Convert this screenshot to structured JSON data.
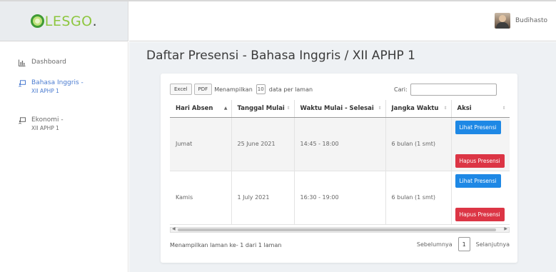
{
  "brand": {
    "name": "LESGO",
    "dot": "."
  },
  "user": {
    "name": "Budihasto"
  },
  "sidebar": {
    "items": [
      {
        "label": "Dashboard",
        "sub": "",
        "icon": "chart-icon"
      },
      {
        "label": "Bahasa Inggris -",
        "sub": "XII APHP 1",
        "icon": "class-board-icon",
        "active": true
      },
      {
        "label": "Ekonomi -",
        "sub": "XII APHP 1",
        "icon": "class-board-icon"
      }
    ]
  },
  "page": {
    "title": "Daftar Presensi - Bahasa Inggris / XII APHP 1"
  },
  "toolbar": {
    "excel_label": "Excel",
    "pdf_label": "PDF",
    "show_prefix": "Menampilkan",
    "page_length": "10",
    "show_suffix": "data per laman",
    "search_label": "Cari:",
    "search_value": ""
  },
  "table": {
    "columns": [
      "Hari Absen",
      "Tanggal Mulai",
      "Waktu Mulai - Selesai",
      "Jangka Waktu",
      "Aksi"
    ],
    "rows": [
      {
        "hari": "Jumat",
        "tanggal": "25 June 2021",
        "waktu": "14:45 - 18:00",
        "jangka": "6 bulan (1 smt)",
        "lihat": "Lihat Presensi",
        "hapus": "Hapus Presensi"
      },
      {
        "hari": "Kamis",
        "tanggal": "1 July 2021",
        "waktu": "16:30 - 19:00",
        "jangka": "6 bulan (1 smt)",
        "lihat": "Lihat Presensi",
        "hapus": "Hapus Presensi"
      }
    ]
  },
  "footer": {
    "info": "Menampilkan laman ke- 1 dari 1 laman",
    "prev_label": "Sebelumnya",
    "current_page": "1",
    "next_label": "Selanjutnya"
  },
  "colors": {
    "accent": "#1e88e5",
    "danger": "#dc3545",
    "brand_green": "#8dc63f",
    "active_nav": "#4a7bd0"
  }
}
